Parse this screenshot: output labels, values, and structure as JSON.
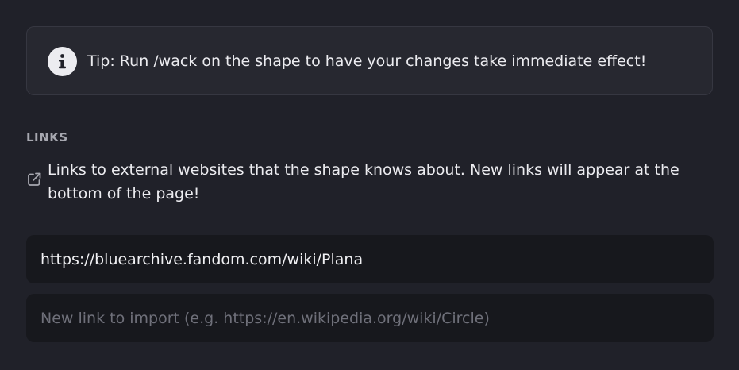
{
  "tip": {
    "icon": "info-icon",
    "text": "Tip: Run /wack on the shape to have your changes take immediate effect!"
  },
  "links_section": {
    "label": "LINKS",
    "icon": "external-link-icon",
    "description": "Links to external websites that the shape knows about. New links will appear at the bottom of the page!",
    "links": [
      "https://bluearchive.fandom.com/wiki/Plana"
    ],
    "new_link": {
      "value": "",
      "placeholder": "New link to import (e.g. https://en.wikipedia.org/wiki/Circle)"
    }
  },
  "colors": {
    "background": "#202129",
    "card": "#272830",
    "input": "#17181d",
    "text": "#ececf0",
    "muted": "#a7a8b0",
    "placeholder": "#6f707a"
  }
}
